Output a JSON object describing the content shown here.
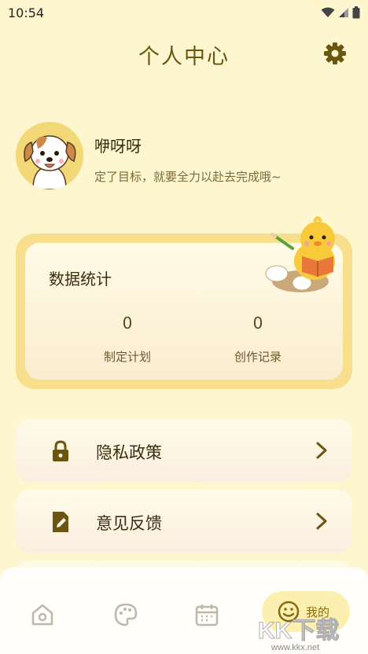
{
  "status_bar": {
    "time": "10:54"
  },
  "header": {
    "title": "个人中心",
    "settings_icon": "gear-icon"
  },
  "profile": {
    "name": "咿呀呀",
    "motto": "定了目标，就要全力以赴去完成哦~"
  },
  "stats": {
    "title": "数据统计",
    "items": [
      {
        "value": "0",
        "label": "制定计划"
      },
      {
        "value": "0",
        "label": "创作记录"
      }
    ]
  },
  "menu": [
    {
      "label": "隐私政策",
      "icon": "lock-icon"
    },
    {
      "label": "意见反馈",
      "icon": "edit-icon"
    }
  ],
  "bottom_nav": {
    "items": [
      {
        "icon": "home-icon"
      },
      {
        "icon": "palette-icon"
      },
      {
        "icon": "calendar-icon"
      },
      {
        "icon": "smile-icon",
        "label": "我的",
        "active": true
      }
    ]
  },
  "watermark": {
    "text": "KK下载",
    "url": "www.kkx.net"
  },
  "colors": {
    "background": "#fdf6cf",
    "accent": "#6a5610",
    "card_border": "#f7df8e",
    "active_nav": "#fcf0b0"
  }
}
